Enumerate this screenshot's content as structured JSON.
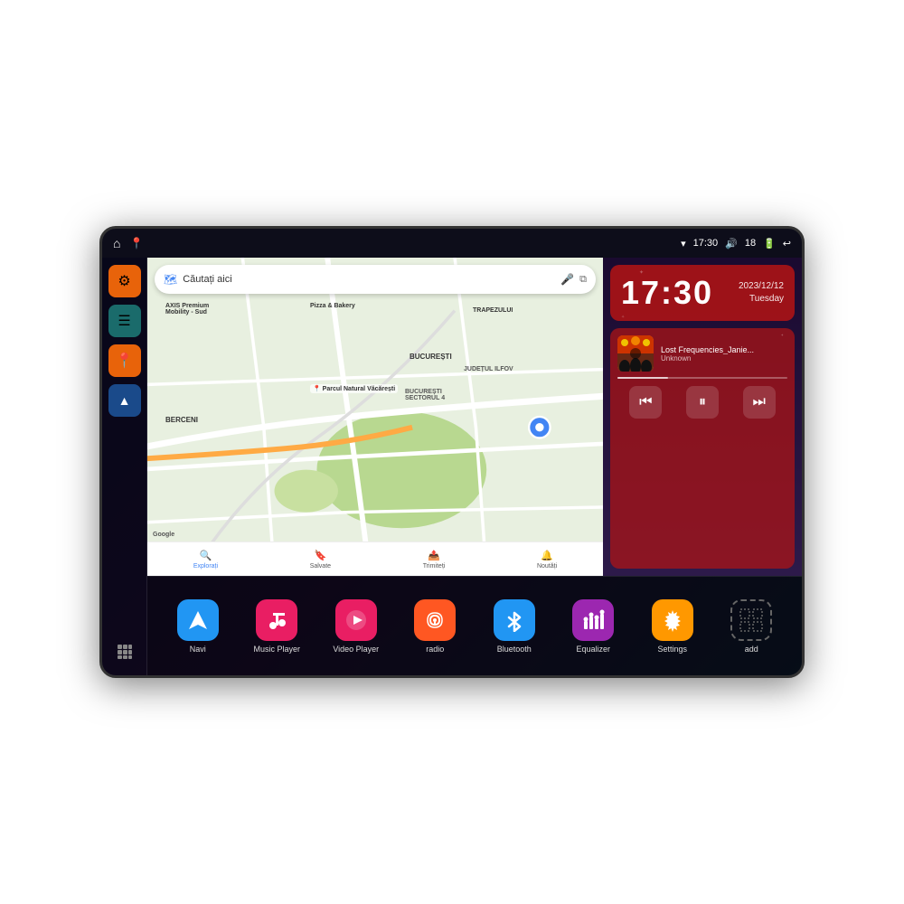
{
  "device": {
    "status_bar": {
      "left_icons": [
        "home",
        "location"
      ],
      "time": "17:30",
      "right_icons": [
        "wifi",
        "volume",
        "18",
        "battery",
        "back"
      ]
    },
    "clock": {
      "time": "17:30",
      "date": "2023/12/12",
      "day": "Tuesday"
    },
    "music": {
      "title": "Lost Frequencies_Janie...",
      "artist": "Unknown",
      "thumbnail_alt": "concert crowd"
    },
    "map": {
      "search_placeholder": "Căutați aici",
      "labels": [
        "AXIS Premium Mobility - Sud",
        "Pizza & Bakery",
        "Parcul Natural Văcărești",
        "BUCUREȘTI",
        "BUCUREȘTI SECTORUL 4",
        "JUDEȚUL ILFOV",
        "BERCENI",
        "TRAPEZULUI"
      ],
      "nav_items": [
        {
          "label": "Explorați",
          "icon": "📍",
          "active": true
        },
        {
          "label": "Salvate",
          "icon": "🔖"
        },
        {
          "label": "Trimiteți",
          "icon": "📤"
        },
        {
          "label": "Noutăți",
          "icon": "🔔"
        }
      ]
    },
    "sidebar": {
      "items": [
        {
          "icon": "⚙",
          "color": "orange",
          "label": "settings"
        },
        {
          "icon": "📁",
          "color": "teal",
          "label": "files"
        },
        {
          "icon": "📍",
          "color": "orange2",
          "label": "map"
        },
        {
          "icon": "▲",
          "color": "blue",
          "label": "navigation"
        },
        {
          "icon": "⋮⋮⋮",
          "color": "grid",
          "label": "grid"
        }
      ]
    },
    "apps": [
      {
        "id": "navi",
        "label": "Navi",
        "icon": "▲",
        "color": "navi"
      },
      {
        "id": "music-player",
        "label": "Music Player",
        "icon": "♪",
        "color": "music"
      },
      {
        "id": "video-player",
        "label": "Video Player",
        "icon": "▶",
        "color": "video"
      },
      {
        "id": "radio",
        "label": "radio",
        "icon": "📻",
        "color": "radio"
      },
      {
        "id": "bluetooth",
        "label": "Bluetooth",
        "icon": "⚡",
        "color": "bluetooth"
      },
      {
        "id": "equalizer",
        "label": "Equalizer",
        "icon": "≡",
        "color": "equalizer"
      },
      {
        "id": "settings",
        "label": "Settings",
        "icon": "⚙",
        "color": "settings"
      },
      {
        "id": "add",
        "label": "add",
        "icon": "+",
        "color": "add"
      }
    ],
    "music_controls": {
      "prev": "⏮",
      "play_pause": "⏸",
      "next": "⏭"
    }
  }
}
